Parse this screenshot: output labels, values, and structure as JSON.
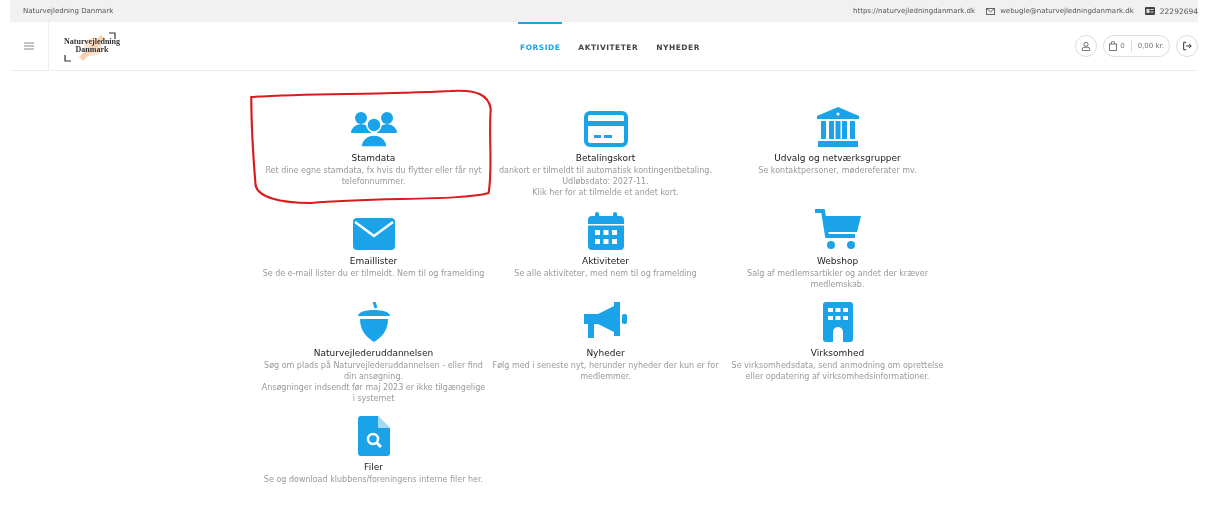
{
  "top_bar": {
    "site_name": "Naturvejledning Danmark",
    "website": "https://naturvejledningdanmark.dk",
    "email": "webugle@naturvejledningdanmark.dk",
    "phone": "22292694"
  },
  "header": {
    "logo_text": "Naturvejledning Danmark",
    "nav": [
      {
        "label": "FORSIDE",
        "selected": true
      },
      {
        "label": "AKTIVITETER",
        "selected": false
      },
      {
        "label": "NYHEDER",
        "selected": false
      }
    ],
    "cart": {
      "count": "0",
      "total": "0,00 kr."
    }
  },
  "tiles": [
    {
      "kind": "people",
      "title": "Stamdata",
      "description": [
        "Ret dine egne stamdata, fx hvis du flytter eller får nyt telefonnummer."
      ],
      "highlighted": true
    },
    {
      "kind": "card",
      "title": "Betalingskort",
      "description": [
        "dankort er tilmeldt til automatisk kontingentbetaling.",
        "Udløbsdato: 2027-11.",
        "Klik her for at tilmelde et andet kort."
      ],
      "highlighted": false
    },
    {
      "kind": "bank",
      "title": "Udvalg og netværksgrupper",
      "description": [
        "Se kontaktpersoner, mødereferater mv."
      ],
      "highlighted": false
    },
    {
      "kind": "mail",
      "title": "Emaillister",
      "description": [
        "Se de e-mail lister du er tilmeldt. Nem til og framelding"
      ],
      "highlighted": false
    },
    {
      "kind": "calendar",
      "title": "Aktiviteter",
      "description": [
        "Se alle aktiviteter, med nem til og framelding"
      ],
      "highlighted": false
    },
    {
      "kind": "cart",
      "title": "Webshop",
      "description": [
        "Salg af medlemsartikler og andet der kræver medlemskab."
      ],
      "highlighted": false
    },
    {
      "kind": "acorn",
      "title": "Naturvejlederuddannelsen",
      "description": [
        "Søg om plads på Naturvejlederuddannelsen - eller find din ansøgning.",
        "Ansøgninger indsendt før maj 2023 er ikke tilgængelige i systemet"
      ],
      "highlighted": false
    },
    {
      "kind": "megaphone",
      "title": "Nyheder",
      "description": [
        "Følg med i seneste nyt, herunder nyheder der kun er for medlemmer."
      ],
      "highlighted": false
    },
    {
      "kind": "building",
      "title": "Virksomhed",
      "description": [
        "Se virksomhedsdata, send anmodning om oprettelse eller opdatering af virksomhedsinformationer."
      ],
      "highlighted": false
    },
    {
      "kind": "file",
      "title": "Filer",
      "description": [
        "Se og download klubbens/foreningens interne filer her."
      ],
      "highlighted": false
    }
  ]
}
